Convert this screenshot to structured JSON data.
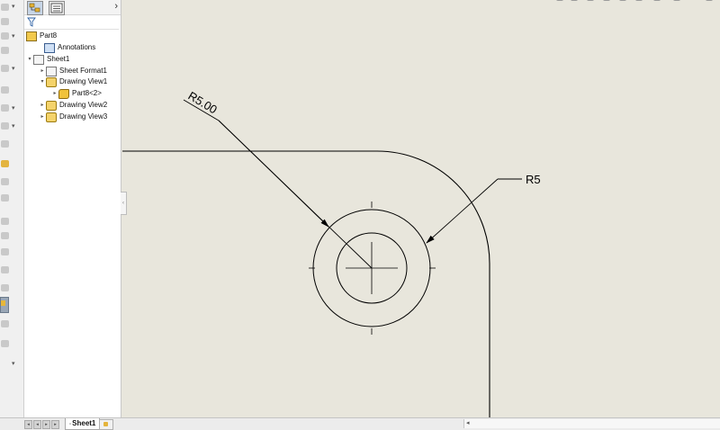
{
  "feature_tree": {
    "root": "Part8",
    "items": [
      {
        "label": "Annotations",
        "icon": "annotations-icon",
        "indent": 1,
        "toggle": ""
      },
      {
        "label": "Sheet1",
        "icon": "sheet-icon",
        "indent": 0,
        "toggle": "▾"
      },
      {
        "label": "Sheet Format1",
        "icon": "sheet-format-icon",
        "indent": 2,
        "toggle": "▸"
      },
      {
        "label": "Drawing View1",
        "icon": "drawing-view-icon",
        "indent": 2,
        "toggle": "▾"
      },
      {
        "label": "Part8<2>",
        "icon": "part-icon",
        "indent": 3,
        "toggle": "▸"
      },
      {
        "label": "Drawing View2",
        "icon": "drawing-view-icon",
        "indent": 2,
        "toggle": "▸"
      },
      {
        "label": "Drawing View3",
        "icon": "drawing-view-icon",
        "indent": 2,
        "toggle": "▸"
      }
    ]
  },
  "drawing": {
    "dimension_left": "R5.00",
    "dimension_right": "R5"
  },
  "bottom_bar": {
    "sheet_tab": "Sheet1"
  },
  "colors": {
    "canvas": "#e8e6dc",
    "geometry": "#000000",
    "panel": "#ffffff"
  }
}
